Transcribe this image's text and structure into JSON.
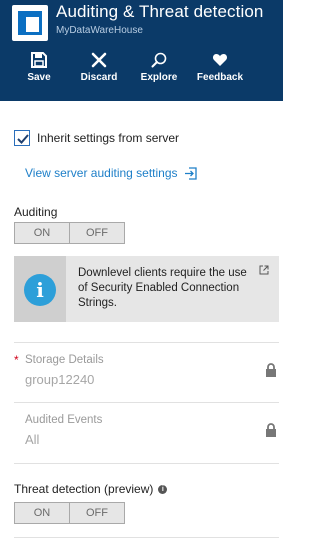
{
  "header": {
    "title": "Auditing & Threat detection",
    "subtitle": "MyDataWareHouse",
    "background": "#0b3a68"
  },
  "toolbar": {
    "items": [
      {
        "label": "Save",
        "icon": "save-icon"
      },
      {
        "label": "Discard",
        "icon": "close-icon"
      },
      {
        "label": "Explore",
        "icon": "search-icon"
      },
      {
        "label": "Feedback",
        "icon": "heart-icon"
      }
    ]
  },
  "inherit": {
    "label": "Inherit settings from server",
    "checked": true
  },
  "link": {
    "label": "View server auditing settings",
    "color": "#1e7fc8"
  },
  "auditing": {
    "label": "Auditing",
    "on_label": "ON",
    "off_label": "OFF"
  },
  "info": {
    "text": "Downlevel clients require the use of Security Enabled Connection Strings.",
    "accent": "#2d9fd9"
  },
  "storage": {
    "label": "Storage Details",
    "required": "*",
    "value": "group12240"
  },
  "audited_events": {
    "label": "Audited Events",
    "value": "All"
  },
  "threat": {
    "label": "Threat detection (preview)",
    "on_label": "ON",
    "off_label": "OFF"
  }
}
